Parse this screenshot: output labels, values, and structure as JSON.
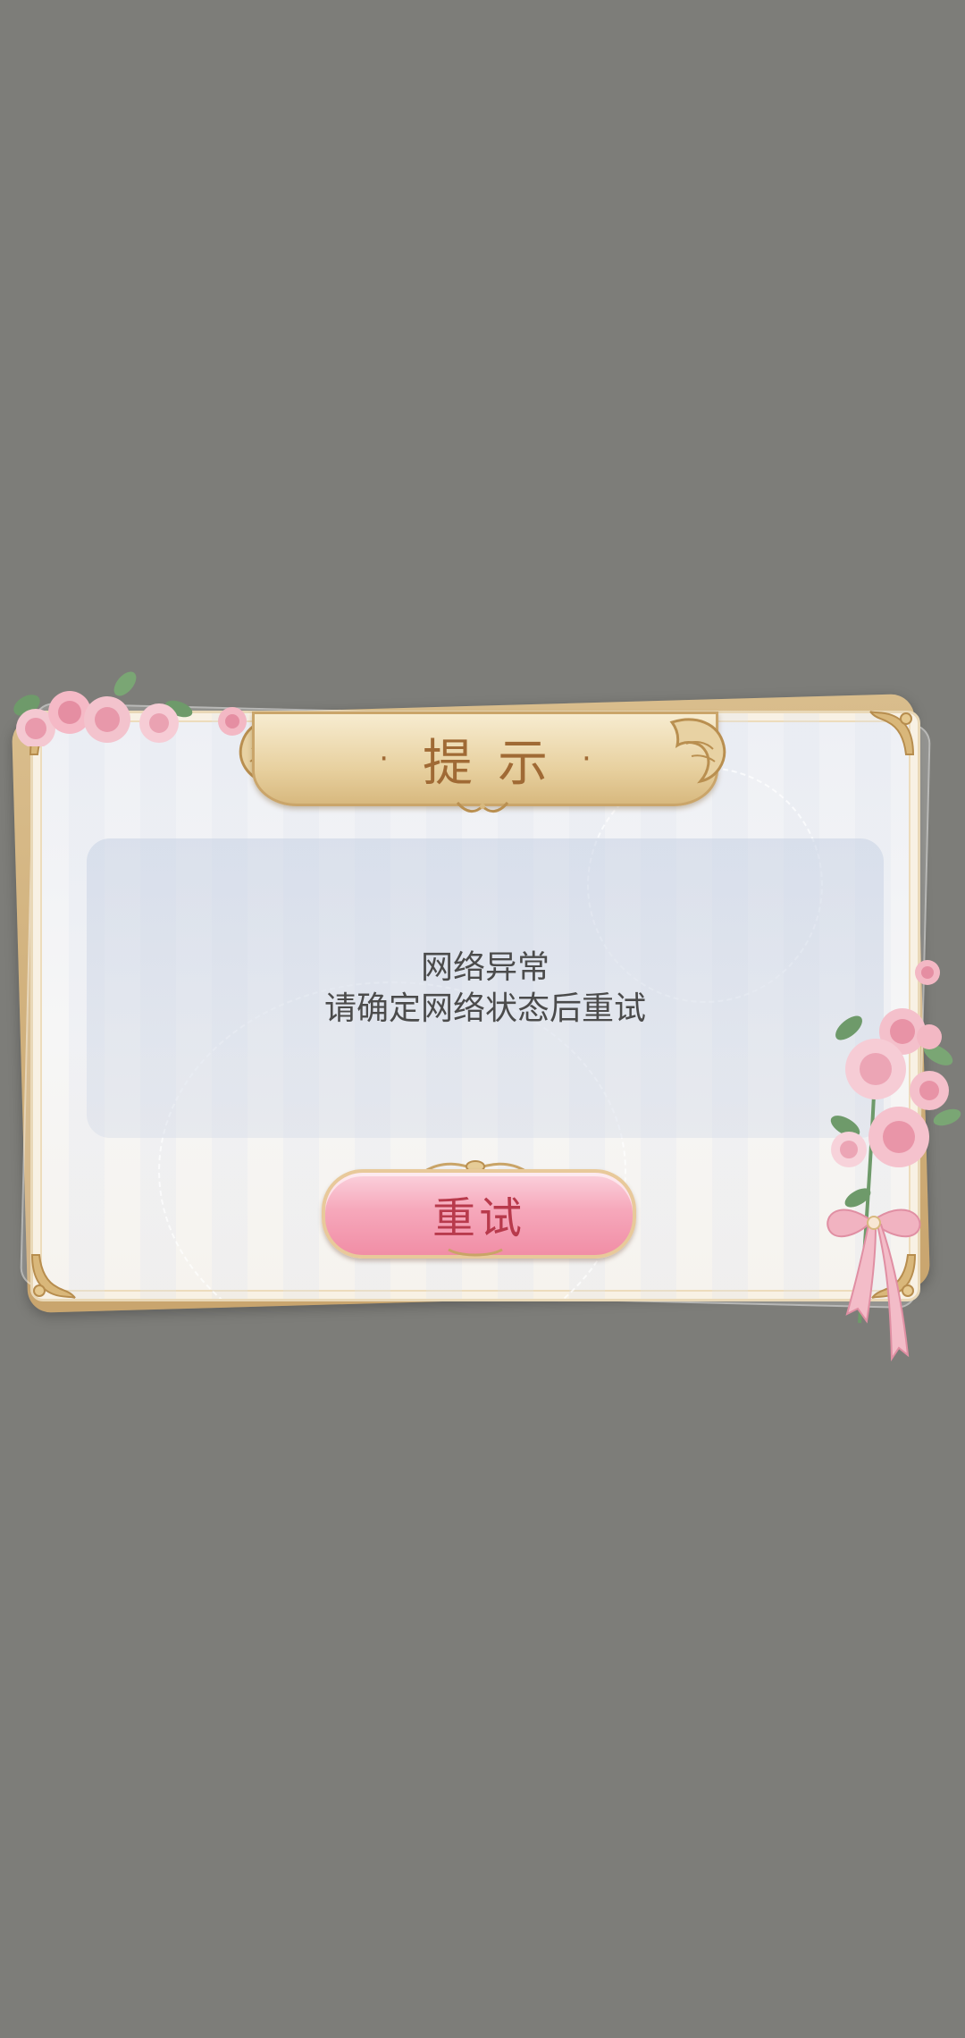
{
  "dialog": {
    "title": "提示",
    "title_dot": "·",
    "message": {
      "line1": "网络异常",
      "line2": "请确定网络状态后重试"
    },
    "retry_label": "重试"
  },
  "colors": {
    "background": "#7d7d79",
    "frame_gold": "#c9a56e",
    "title_text": "#a06a35",
    "button_pink": "#f6a8bb",
    "button_text": "#b83a4c",
    "message_text": "#4b4b4b"
  },
  "icons": [
    "rose-bouquet-icon",
    "corner-ornament-icon",
    "wing-ornament-icon",
    "ribbon-bow-icon"
  ]
}
